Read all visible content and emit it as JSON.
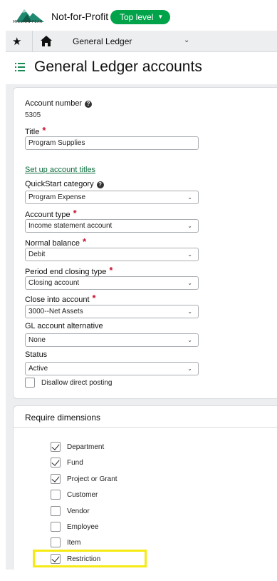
{
  "brand": {
    "logo_text": "MISSION PEAK",
    "company": "Not-for-Profit",
    "level_label": "Top level",
    "accent": "#00a34a"
  },
  "nav": {
    "module": "General Ledger"
  },
  "page": {
    "title": "General Ledger accounts"
  },
  "form": {
    "account_number_label": "Account number",
    "account_number_value": "5305",
    "title_label": "Title",
    "title_value": "Program Supplies",
    "setup_link": "Set up account titles",
    "quickstart_label": "QuickStart category",
    "quickstart_value": "Program Expense",
    "account_type_label": "Account type",
    "account_type_value": "Income statement account",
    "normal_balance_label": "Normal balance",
    "normal_balance_value": "Debit",
    "closing_type_label": "Period end closing type",
    "closing_type_value": "Closing account",
    "close_into_label": "Close into account",
    "close_into_value": "3000--Net Assets",
    "gl_alt_label": "GL account alternative",
    "gl_alt_value": "None",
    "status_label": "Status",
    "status_value": "Active",
    "disallow_label": "Disallow direct posting",
    "disallow_checked": false
  },
  "dimensions": {
    "title": "Require dimensions",
    "items": [
      {
        "label": "Department",
        "checked": true
      },
      {
        "label": "Fund",
        "checked": true
      },
      {
        "label": "Project or Grant",
        "checked": true
      },
      {
        "label": "Customer",
        "checked": false
      },
      {
        "label": "Vendor",
        "checked": false
      },
      {
        "label": "Employee",
        "checked": false
      },
      {
        "label": "Item",
        "checked": false
      },
      {
        "label": "Restriction",
        "checked": true
      }
    ],
    "highlight_color": "#f5ea14"
  }
}
